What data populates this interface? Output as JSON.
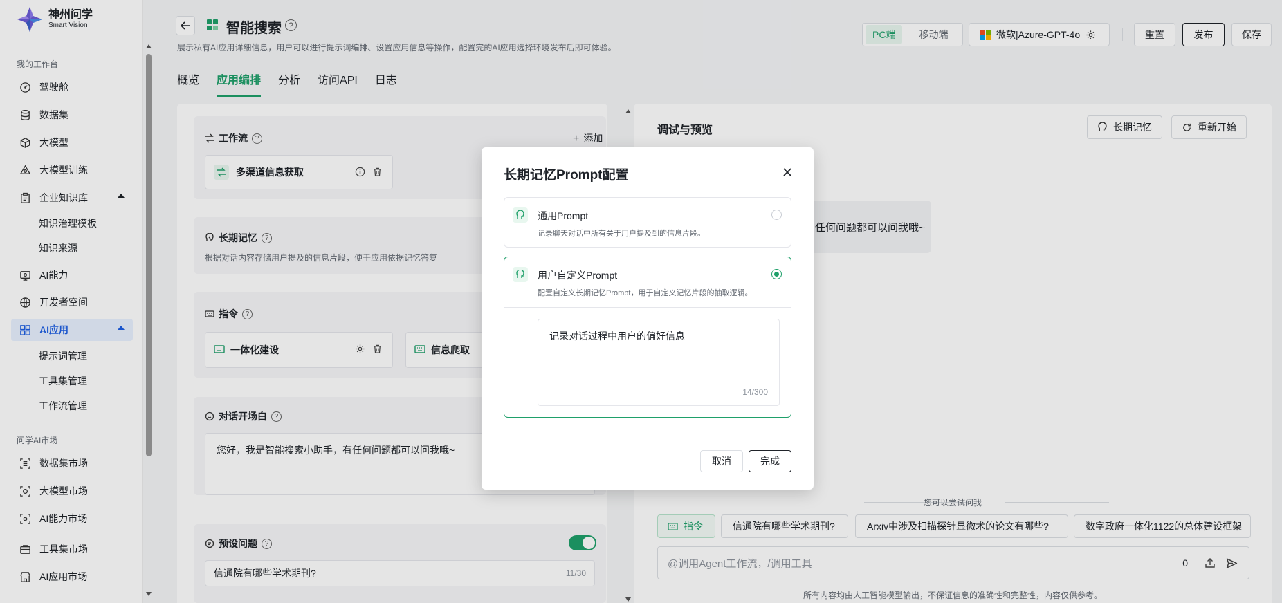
{
  "brand": {
    "name_cn": "神州问学",
    "name_en": "Smart Vision"
  },
  "sidebar": {
    "group1": "我的工作台",
    "items": [
      {
        "label": "驾驶舱",
        "icon": "dashboard-icon"
      },
      {
        "label": "数据集",
        "icon": "database-icon"
      },
      {
        "label": "大模型",
        "icon": "cube-icon"
      },
      {
        "label": "大模型训练",
        "icon": "training-icon"
      },
      {
        "label": "企业知识库",
        "icon": "clipboard-icon"
      },
      {
        "label": "AI能力",
        "icon": "ai-capability-icon"
      },
      {
        "label": "开发者空间",
        "icon": "developer-icon"
      },
      {
        "label": "AI应用",
        "icon": "grid-apps-icon"
      }
    ],
    "kb_sub": [
      "知识治理模板",
      "知识来源"
    ],
    "app_sub": [
      "提示词管理",
      "工具集管理",
      "工作流管理"
    ],
    "group2": "问学AI市场",
    "market": [
      {
        "label": "数据集市场",
        "icon": "dataset-market-icon"
      },
      {
        "label": "大模型市场",
        "icon": "model-market-icon"
      },
      {
        "label": "AI能力市场",
        "icon": "ai-market-icon"
      },
      {
        "label": "工具集市场",
        "icon": "toolbox-market-icon"
      },
      {
        "label": "AI应用市场",
        "icon": "app-market-icon"
      }
    ]
  },
  "header": {
    "title": "智能搜索",
    "desc": "展示私有AI应用详细信息，用户可以进行提示词编排、设置应用信息等操作，配置完的AI应用选择环境发布后即可体验。",
    "tabs": [
      "概览",
      "应用编排",
      "分析",
      "访问API",
      "日志"
    ],
    "platform": [
      "PC端",
      "移动端"
    ],
    "model": "微软|Azure-GPT-4o",
    "reset": "重置",
    "publish": "发布",
    "save": "保存"
  },
  "config": {
    "workflow": {
      "title": "工作流",
      "add": "添加",
      "item": "多渠道信息获取"
    },
    "memory": {
      "title": "长期记忆",
      "desc": "根据对话内容存储用户提及的信息片段，便于应用依据记忆答复"
    },
    "command": {
      "title": "指令",
      "items": [
        "一体化建设",
        "信息爬取"
      ]
    },
    "opening": {
      "title": "对话开场白",
      "text": "您好，我是智能搜索小助手，有任何问题都可以问我哦~"
    },
    "preset": {
      "title": "预设问题",
      "q1": "信通院有哪些学术期刊?",
      "q1_count": "11/30"
    }
  },
  "preview": {
    "title": "调试与预览",
    "memory_btn": "长期记忆",
    "restart_btn": "重新开始",
    "bubble": "任何问题都可以问我哦~",
    "try_label": "您可以尝试问我",
    "cmd_chip": "指令",
    "suggestions": [
      "信通院有哪些学术期刊?",
      "Arxiv中涉及扫描探针显微术的论文有哪些?",
      "数字政府一体化1122的总体建设框架"
    ],
    "input_placeholder": "@调用Agent工作流，/调用工具",
    "input_count": "0",
    "disclaimer": "所有内容均由人工智能模型输出，不保证信息的准确性和完整性，内容仅供参考。"
  },
  "modal": {
    "title": "长期记忆Prompt配置",
    "opt1": {
      "title": "通用Prompt",
      "desc": "记录聊天对话中所有关于用户提及到的信息片段。"
    },
    "opt2": {
      "title": "用户自定义Prompt",
      "desc": "配置自定义长期记忆Prompt，用于自定义记忆片段的抽取逻辑。"
    },
    "prompt_text": "记录对话过程中用户的偏好信息",
    "prompt_count": "14/300",
    "cancel": "取消",
    "done": "完成"
  },
  "colors": {
    "accent": "#1fa06a",
    "nav_active": "#1d5fe4"
  }
}
